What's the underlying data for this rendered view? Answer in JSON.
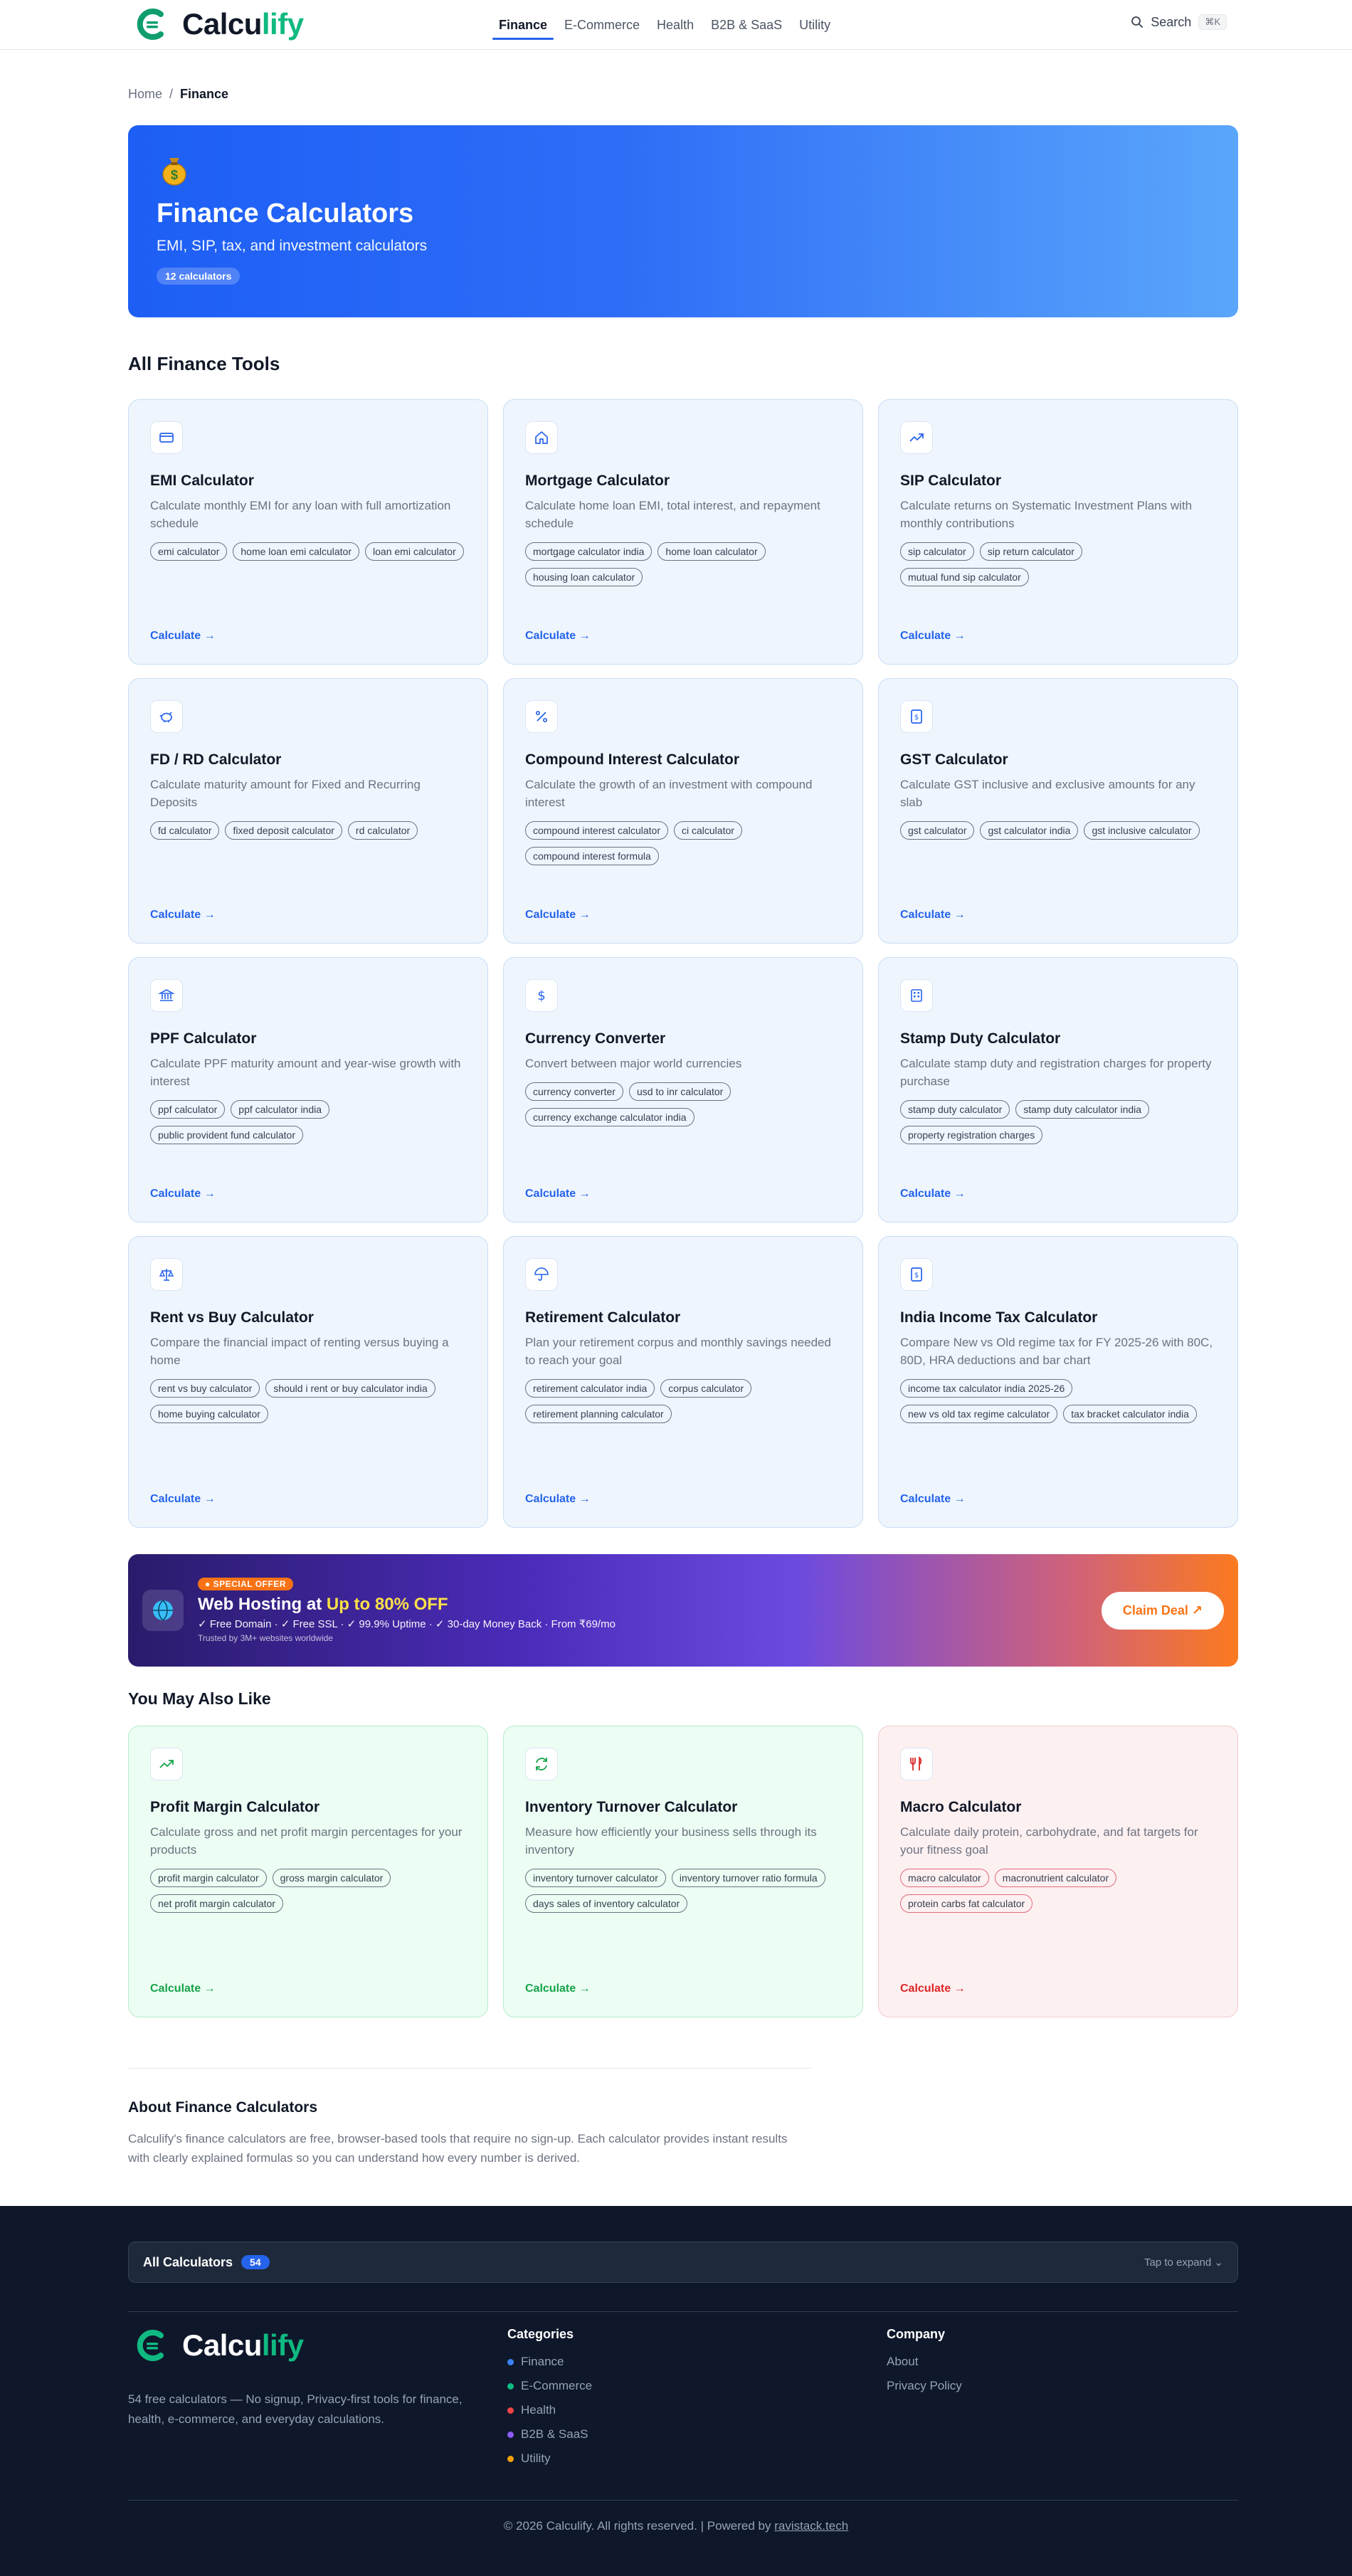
{
  "brand": {
    "name_main": "Calcu",
    "name_accent": "lify"
  },
  "nav": [
    {
      "label": "Finance",
      "active": true
    },
    {
      "label": "E-Commerce"
    },
    {
      "label": "Health"
    },
    {
      "label": "B2B & SaaS"
    },
    {
      "label": "Utility"
    }
  ],
  "search": {
    "label": "Search",
    "shortcut": "⌘K"
  },
  "breadcrumb": {
    "home": "Home",
    "sep": "/",
    "current": "Finance"
  },
  "hero": {
    "icon": "money-bag-icon",
    "title": "Finance Calculators",
    "subtitle": "EMI, SIP, tax, and investment calculators",
    "badge": "12 calculators"
  },
  "tools_title": "All Finance Tools",
  "tools": [
    {
      "title": "EMI Calculator",
      "desc": "Calculate monthly EMI for any loan with full amortization schedule",
      "tags": [
        "emi calculator",
        "home loan emi calculator",
        "loan emi calculator"
      ],
      "link": "Calculate →",
      "icon": "credit-card-icon"
    },
    {
      "title": "Mortgage Calculator",
      "desc": "Calculate home loan EMI, total interest, and repayment schedule",
      "tags": [
        "mortgage calculator india",
        "home loan calculator",
        "housing loan calculator"
      ],
      "link": "Calculate →",
      "icon": "home-icon"
    },
    {
      "title": "SIP Calculator",
      "desc": "Calculate returns on Systematic Investment Plans with monthly contributions",
      "tags": [
        "sip calculator",
        "sip return calculator",
        "mutual fund sip calculator"
      ],
      "link": "Calculate →",
      "icon": "trending-up-icon"
    },
    {
      "title": "FD / RD Calculator",
      "desc": "Calculate maturity amount for Fixed and Recurring Deposits",
      "tags": [
        "fd calculator",
        "fixed deposit calculator",
        "rd calculator"
      ],
      "link": "Calculate →",
      "icon": "piggy-bank-icon"
    },
    {
      "title": "Compound Interest Calculator",
      "desc": "Calculate the growth of an investment with compound interest",
      "tags": [
        "compound interest calculator",
        "ci calculator",
        "compound interest formula"
      ],
      "link": "Calculate →",
      "icon": "percent-icon"
    },
    {
      "title": "GST Calculator",
      "desc": "Calculate GST inclusive and exclusive amounts for any slab",
      "tags": [
        "gst calculator",
        "gst calculator india",
        "gst inclusive calculator"
      ],
      "link": "Calculate →",
      "icon": "receipt-icon"
    },
    {
      "title": "PPF Calculator",
      "desc": "Calculate PPF maturity amount and year-wise growth with interest",
      "tags": [
        "ppf calculator",
        "ppf calculator india",
        "public provident fund calculator"
      ],
      "link": "Calculate →",
      "icon": "bank-icon"
    },
    {
      "title": "Currency Converter",
      "desc": "Convert between major world currencies",
      "tags": [
        "currency converter",
        "usd to inr calculator",
        "currency exchange calculator india"
      ],
      "link": "Calculate →",
      "icon": "dollar-icon"
    },
    {
      "title": "Stamp Duty Calculator",
      "desc": "Calculate stamp duty and registration charges for property purchase",
      "tags": [
        "stamp duty calculator",
        "stamp duty calculator india",
        "property registration charges"
      ],
      "link": "Calculate →",
      "icon": "building-icon"
    },
    {
      "title": "Rent vs Buy Calculator",
      "desc": "Compare the financial impact of renting versus buying a home",
      "tags": [
        "rent vs buy calculator",
        "should i rent or buy calculator india",
        "home buying calculator"
      ],
      "link": "Calculate →",
      "icon": "scale-icon"
    },
    {
      "title": "Retirement Calculator",
      "desc": "Plan your retirement corpus and monthly savings needed to reach your goal",
      "tags": [
        "retirement calculator india",
        "corpus calculator",
        "retirement planning calculator"
      ],
      "link": "Calculate →",
      "icon": "umbrella-icon"
    },
    {
      "title": "India Income Tax Calculator",
      "desc": "Compare New vs Old regime tax for FY 2025-26 with 80C, 80D, HRA deductions and bar chart",
      "tags": [
        "income tax calculator india 2025-26",
        "new vs old tax regime calculator",
        "tax bracket calculator india"
      ],
      "link": "Calculate →",
      "icon": "receipt-icon"
    }
  ],
  "ad": {
    "pill": "● SPECIAL OFFER",
    "title_main": "Web Hosting at ",
    "title_highlight": "Up to 80% OFF",
    "features": "✓ Free Domain  ·  ✓ Free SSL  ·  ✓ 99.9% Uptime  ·  ✓ 30-day Money Back  ·  From ₹69/mo",
    "trust": "Trusted by 3M+ websites worldwide",
    "button": "Claim Deal ↗"
  },
  "also_title": "You May Also Like",
  "also": [
    {
      "title": "Profit Margin Calculator",
      "desc": "Calculate gross and net profit margin percentages for your products",
      "tags": [
        "profit margin calculator",
        "gross margin calculator",
        "net profit margin calculator"
      ],
      "link": "Calculate →",
      "icon": "trending-up-icon",
      "theme": "green"
    },
    {
      "title": "Inventory Turnover Calculator",
      "desc": "Measure how efficiently your business sells through its inventory",
      "tags": [
        "inventory turnover calculator",
        "inventory turnover ratio formula",
        "days sales of inventory calculator"
      ],
      "link": "Calculate →",
      "icon": "refresh-icon",
      "theme": "green"
    },
    {
      "title": "Macro Calculator",
      "desc": "Calculate daily protein, carbohydrate, and fat targets for your fitness goal",
      "tags": [
        "macro calculator",
        "macronutrient calculator",
        "protein carbs fat calculator"
      ],
      "link": "Calculate →",
      "icon": "utensils-icon",
      "theme": "pink"
    }
  ],
  "about": {
    "title": "About Finance Calculators",
    "text": "Calculify's finance calculators are free, browser-based tools that require no sign-up. Each calculator provides instant results with clearly explained formulas so you can understand how every number is derived."
  },
  "footer": {
    "all_label": "All Calculators",
    "all_count": "54",
    "expand": "Tap to expand",
    "tagline": "54 free calculators — No signup, Privacy-first tools for finance, health, e-commerce, and everyday calculations.",
    "categories_title": "Categories",
    "categories": [
      {
        "label": "Finance",
        "color": "#3b82f6"
      },
      {
        "label": "E-Commerce",
        "color": "#10b981"
      },
      {
        "label": "Health",
        "color": "#ef4444"
      },
      {
        "label": "B2B & SaaS",
        "color": "#8b5cf6"
      },
      {
        "label": "Utility",
        "color": "#f59e0b"
      }
    ],
    "company_title": "Company",
    "company": [
      "About",
      "Privacy Policy"
    ],
    "copyright": "© 2026 Calculify. All rights reserved.",
    "powered_sep": " | Powered by ",
    "powered_link": "ravistack.tech"
  },
  "colors": {
    "accent": "#2563eb",
    "brand_green": "#10b981",
    "footer_bg": "#0f172a"
  }
}
